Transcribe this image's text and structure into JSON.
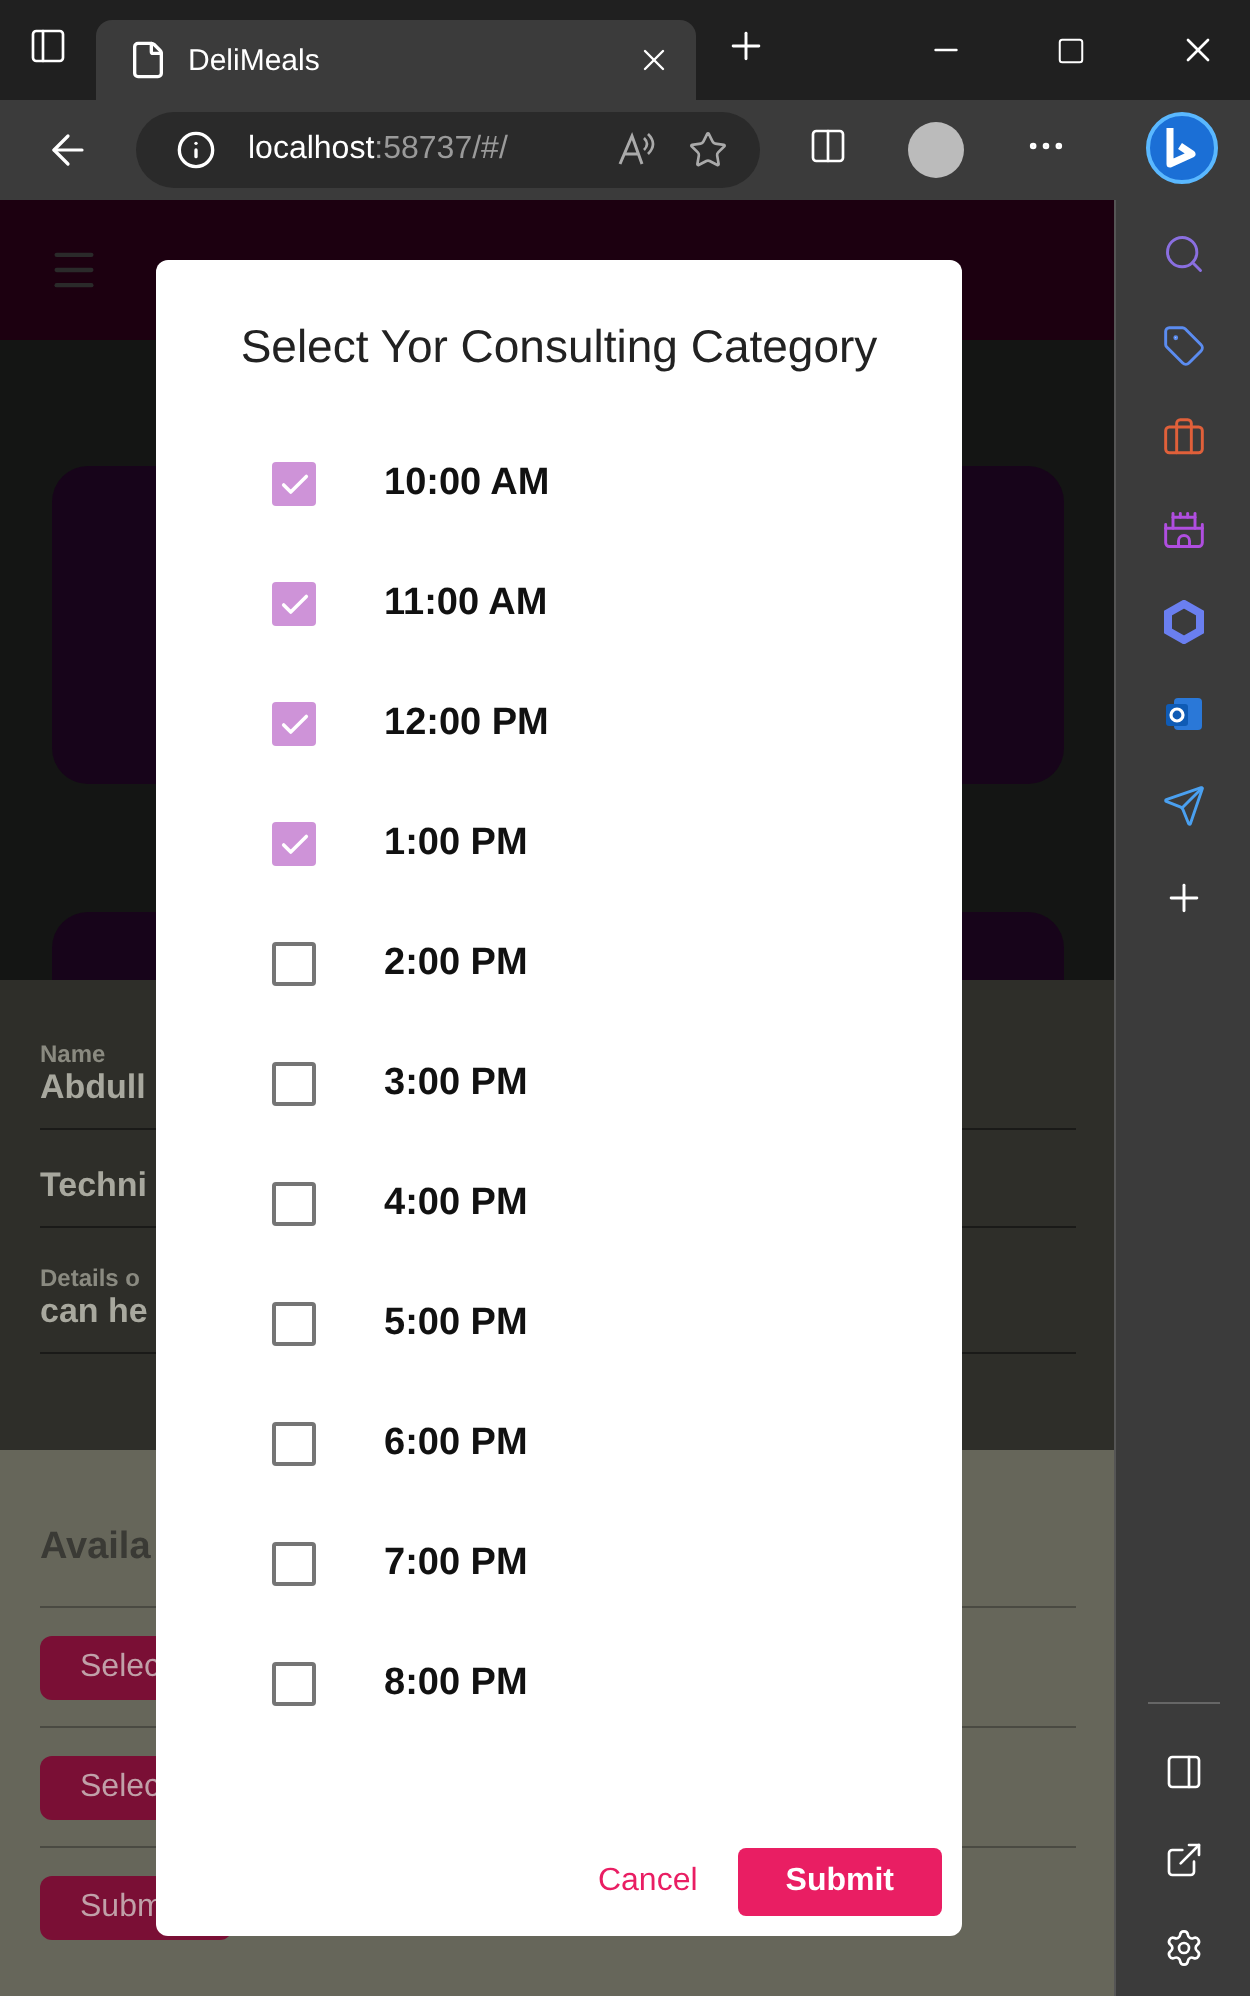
{
  "browser": {
    "tab_title": "DeliMeals",
    "url_host": "localhost",
    "url_rest": ":58737/#/"
  },
  "background": {
    "fields": [
      {
        "label": "Name",
        "value": "Abdull"
      },
      {
        "value": "Techni"
      },
      {
        "label": "Details o",
        "value": "can he"
      }
    ],
    "section_title": "Availa",
    "buttons": [
      "Selec",
      "Selec",
      "Subm"
    ]
  },
  "dialog": {
    "title": "Select Yor Consulting Category",
    "options": [
      {
        "label": "10:00 AM",
        "checked": true
      },
      {
        "label": "11:00 AM",
        "checked": true
      },
      {
        "label": "12:00 PM",
        "checked": true
      },
      {
        "label": "1:00 PM",
        "checked": true
      },
      {
        "label": "2:00 PM",
        "checked": false
      },
      {
        "label": "3:00 PM",
        "checked": false
      },
      {
        "label": "4:00 PM",
        "checked": false
      },
      {
        "label": "5:00 PM",
        "checked": false
      },
      {
        "label": "6:00 PM",
        "checked": false
      },
      {
        "label": "7:00 PM",
        "checked": false
      },
      {
        "label": "8:00 PM",
        "checked": false
      }
    ],
    "buttons": [
      {
        "label": "Cancel",
        "kind": "text"
      },
      {
        "label": "Submit",
        "kind": "filled"
      }
    ]
  }
}
